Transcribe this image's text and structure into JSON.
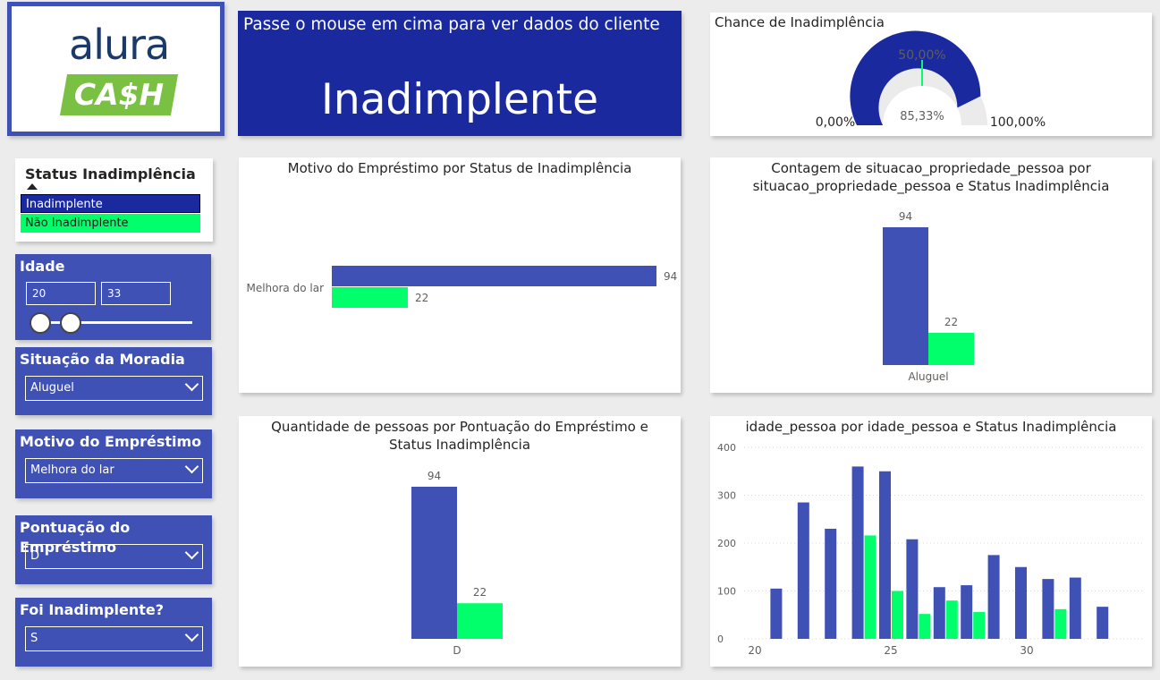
{
  "logo": {
    "top": "alura",
    "bottom": "CA$H"
  },
  "hover": {
    "hint": "Passe o mouse em cima para ver dados do cliente",
    "status": "Inadimplente"
  },
  "gauge": {
    "title": "Chance de Inadimplência",
    "value_label": "85,33%",
    "min_label": "0,00%",
    "max_label": "100,00%",
    "target_label": "50,00%",
    "value": 0.8533,
    "target": 0.5
  },
  "filters": {
    "status": {
      "title": "Status Inadimplência",
      "options": [
        "Inadimplente",
        "Não Inadimplente"
      ]
    },
    "idade": {
      "title": "Idade",
      "min": "20",
      "max": "33"
    },
    "moradia": {
      "title": "Situação da Moradia",
      "value": "Aluguel"
    },
    "motivo": {
      "title": "Motivo do Empréstimo",
      "value": "Melhora do lar"
    },
    "pontuacao": {
      "title": "Pontuação do Empréstimo",
      "value": "D"
    },
    "foi": {
      "title": "Foi Inadimplente?",
      "value": "S"
    }
  },
  "colors": {
    "inad": "#3f51b5",
    "nao": "#00ff6a",
    "navy": "#1a2a9e"
  },
  "chart_data": [
    {
      "type": "bar",
      "orientation": "horizontal",
      "title": "Motivo do Empréstimo por Status de Inadimplência",
      "categories": [
        "Melhora do lar"
      ],
      "series": [
        {
          "name": "Inadimplente",
          "values": [
            94
          ]
        },
        {
          "name": "Não Inadimplente",
          "values": [
            22
          ]
        }
      ],
      "labels": [
        "94",
        "22"
      ]
    },
    {
      "type": "bar",
      "title": "Contagem de situacao_propriedade_pessoa por situacao_propriedade_pessoa e Status Inadimplência",
      "title_lines": [
        "Contagem de situacao_propriedade_pessoa por",
        "situacao_propriedade_pessoa e Status Inadimplência"
      ],
      "categories": [
        "Aluguel"
      ],
      "series": [
        {
          "name": "Inadimplente",
          "values": [
            94
          ]
        },
        {
          "name": "Não Inadimplente",
          "values": [
            22
          ]
        }
      ],
      "labels": [
        "94",
        "22"
      ]
    },
    {
      "type": "bar",
      "title": "Quantidade de pessoas por Pontuação do Empréstimo e Status Inadimplência",
      "title_lines": [
        "Quantidade de pessoas por Pontuação do Empréstimo e",
        "Status Inadimplência"
      ],
      "categories": [
        "D"
      ],
      "series": [
        {
          "name": "Inadimplente",
          "values": [
            94
          ]
        },
        {
          "name": "Não Inadimplente",
          "values": [
            22
          ]
        }
      ],
      "labels": [
        "94",
        "22"
      ]
    },
    {
      "type": "bar",
      "title": "idade_pessoa por idade_pessoa e Status Inadimplência",
      "x": [
        21,
        22,
        23,
        24,
        25,
        26,
        27,
        28,
        29,
        30,
        31,
        32,
        33
      ],
      "series": [
        {
          "name": "Inadimplente",
          "values": [
            105,
            285,
            230,
            360,
            350,
            208,
            108,
            112,
            175,
            150,
            125,
            128,
            67
          ]
        },
        {
          "name": "Não Inadimplente",
          "values": [
            0,
            0,
            0,
            216,
            100,
            52,
            80,
            56,
            0,
            0,
            62,
            0,
            0
          ]
        }
      ],
      "yticks": [
        "0",
        "100",
        "200",
        "300",
        "400"
      ],
      "xticks": [
        "20",
        "25",
        "30"
      ],
      "ylim": [
        0,
        400
      ],
      "xlim": [
        20,
        34
      ],
      "grid": true
    }
  ]
}
